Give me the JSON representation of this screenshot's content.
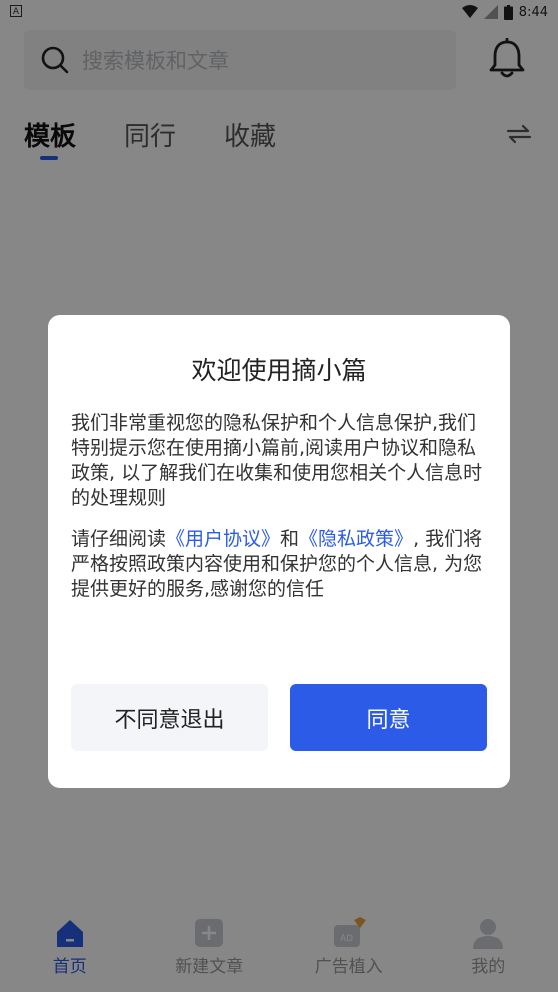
{
  "status": {
    "time": "8:44",
    "left_icon": "A"
  },
  "search": {
    "placeholder": "搜索模板和文章"
  },
  "tabs": [
    {
      "label": "模板"
    },
    {
      "label": "同行"
    },
    {
      "label": "收藏"
    }
  ],
  "bottom_nav": [
    {
      "label": "首页",
      "icon": "home-icon"
    },
    {
      "label": "新建文章",
      "icon": "plus-box-icon"
    },
    {
      "label": "广告植入",
      "icon": "ad-icon"
    },
    {
      "label": "我的",
      "icon": "user-icon"
    }
  ],
  "dialog": {
    "title": "欢迎使用摘小篇",
    "para1": "我们非常重视您的隐私保护和个人信息保护,我们特别提示您在使用摘小篇前,阅读用户协议和隐私政策, 以了解我们在收集和使用您相关个人信息时的处理规则",
    "para2_prefix": "请仔细阅读",
    "link_user": "《用户协议》",
    "para2_and": "和",
    "link_privacy": "《隐私政策》",
    "para2_suffix": ", 我们将严格按照政策内容使用和保护您的个人信息, 为您提供更好的服务,感谢您的信任",
    "disagree_label": "不同意退出",
    "agree_label": "同意"
  },
  "colors": {
    "accent": "#2c5be8",
    "overlay": "rgba(0,0,0,0.47)"
  }
}
